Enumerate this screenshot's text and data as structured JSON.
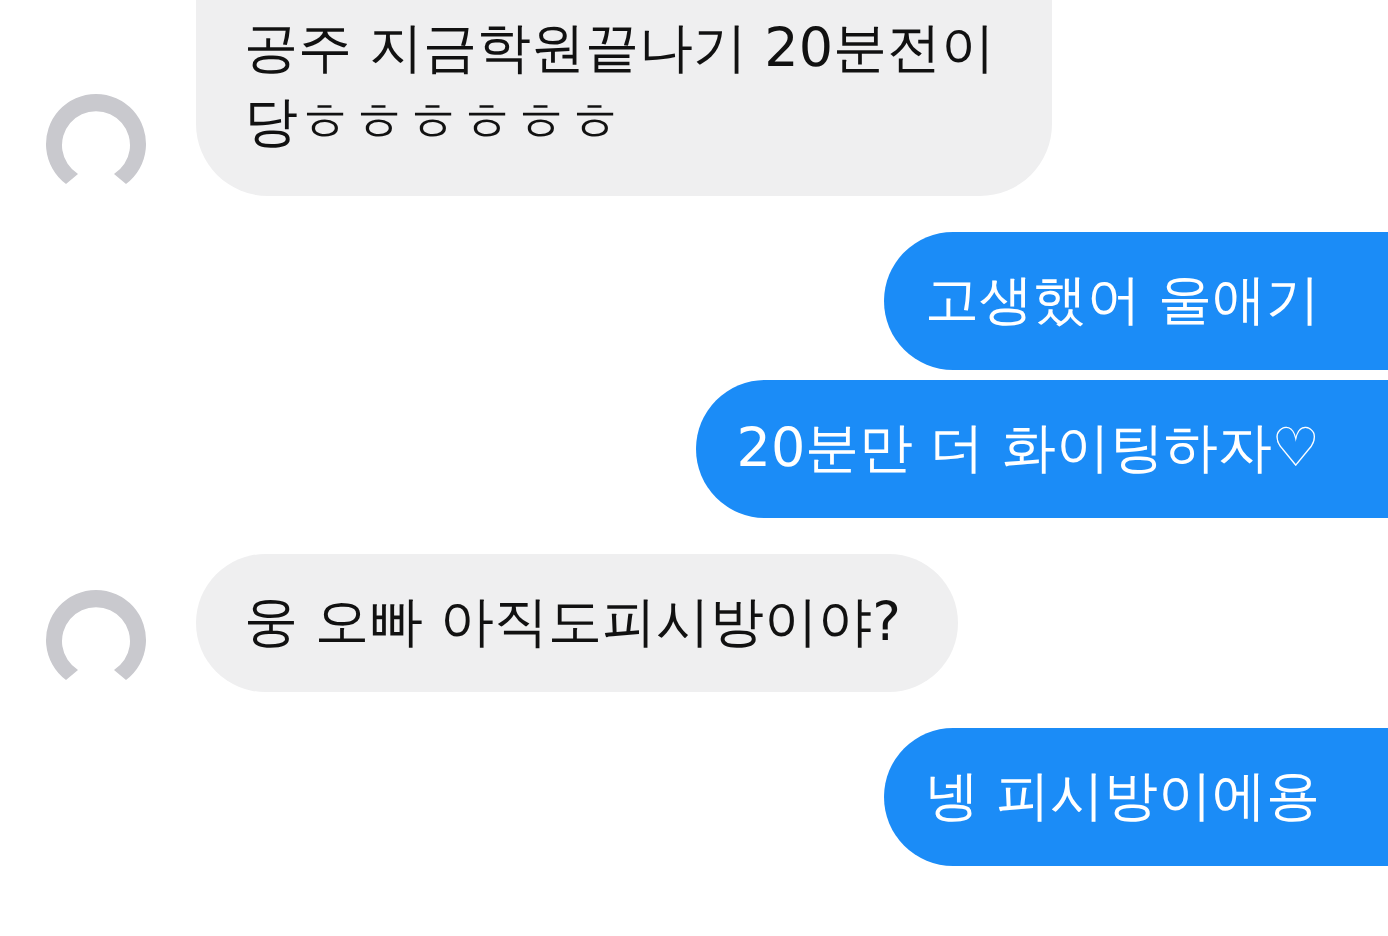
{
  "messages": [
    {
      "kind": "received",
      "text": "공주 지금학원끝나기 20분전이\n당ㅎㅎㅎㅎㅎㅎ"
    },
    {
      "kind": "sent",
      "text": "고생했어 울애기"
    },
    {
      "kind": "sent",
      "text": "20분만 더 화이팅하자♡"
    },
    {
      "kind": "received",
      "text": "웅 오빠 아직도피시방이야?"
    },
    {
      "kind": "sent",
      "text": "넹 피시방이에용"
    }
  ]
}
